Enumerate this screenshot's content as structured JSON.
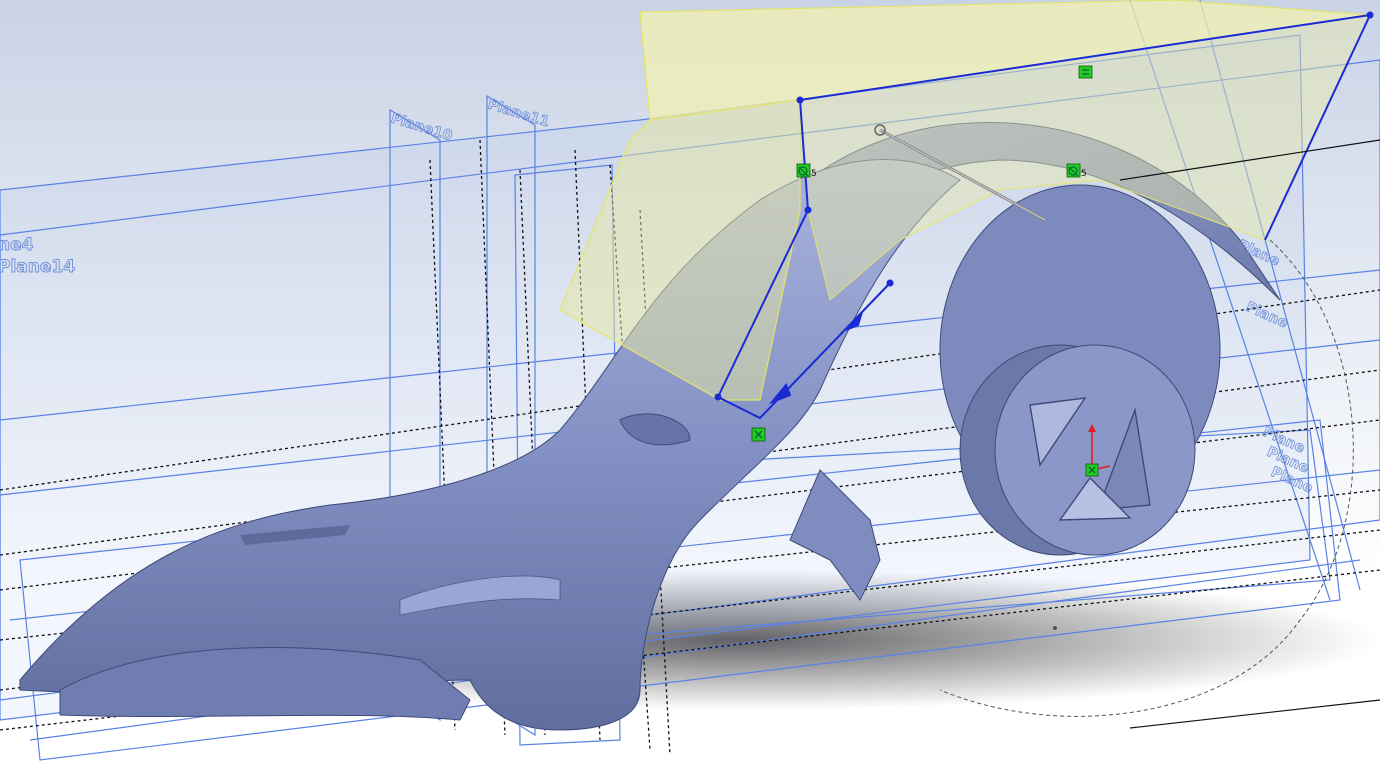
{
  "viewport": {
    "background_top": "#c9d3e6",
    "background_bottom": "#ffffff",
    "model_color": "#8391c4",
    "plane_color": "#5a82e6",
    "sketch_color": "#1a2bd6",
    "surface_highlight": "#f2f2b0",
    "relation_color": "#22cc22"
  },
  "planes": {
    "plane4_label": "ne4",
    "plane14_label": "Plane14",
    "plane10_label": "Plane10",
    "plane11_label": "Plane11",
    "right_labels": [
      "Plane",
      "Plane",
      "Plane",
      "Plane",
      "Plane"
    ]
  },
  "sketch": {
    "relation_a_value": "5",
    "relation_b_value": "5"
  },
  "icons": {
    "origin": "origin-triad-icon",
    "relation_equal": "equal-relation-icon",
    "relation_coincident": "coincident-relation-icon",
    "relation_pierce": "pierce-relation-icon"
  }
}
